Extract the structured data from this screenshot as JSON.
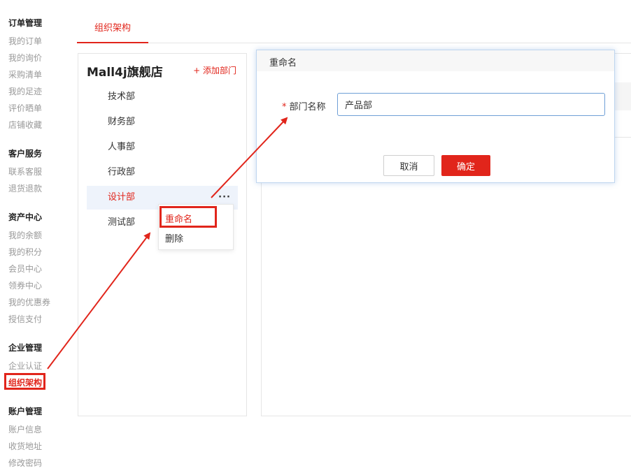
{
  "sidebar": {
    "groups": [
      {
        "title": "订单管理",
        "items": [
          "我的订单",
          "我的询价",
          "采购清单",
          "我的足迹",
          "评价晒单",
          "店铺收藏"
        ]
      },
      {
        "title": "客户服务",
        "items": [
          "联系客服",
          "退货退款"
        ]
      },
      {
        "title": "资产中心",
        "items": [
          "我的余额",
          "我的积分",
          "会员中心",
          "领券中心",
          "我的优惠券",
          "授信支付"
        ]
      },
      {
        "title": "企业管理",
        "items": [
          "企业认证",
          "组织架构"
        ]
      },
      {
        "title": "账户管理",
        "items": [
          "账户信息",
          "收货地址",
          "修改密码"
        ]
      }
    ],
    "active_item": "组织架构"
  },
  "tabs": {
    "active": "组织架构"
  },
  "dept_panel": {
    "store_name": "Mall4j旗舰店",
    "add_label": "+ 添加部门",
    "departments": [
      "技术部",
      "财务部",
      "人事部",
      "行政部",
      "设计部",
      "测试部"
    ],
    "selected": "设计部",
    "more_label": "···"
  },
  "context_menu": {
    "items": [
      "重命名",
      "删除"
    ]
  },
  "dialog": {
    "title": "重命名",
    "required_mark": "*",
    "field_label": "部门名称",
    "field_value": "产品部",
    "cancel_label": "取消",
    "confirm_label": "确定"
  },
  "colors": {
    "accent": "#e1251b",
    "selected_bg": "#eef3fb",
    "input_border": "#6f9fd6"
  }
}
